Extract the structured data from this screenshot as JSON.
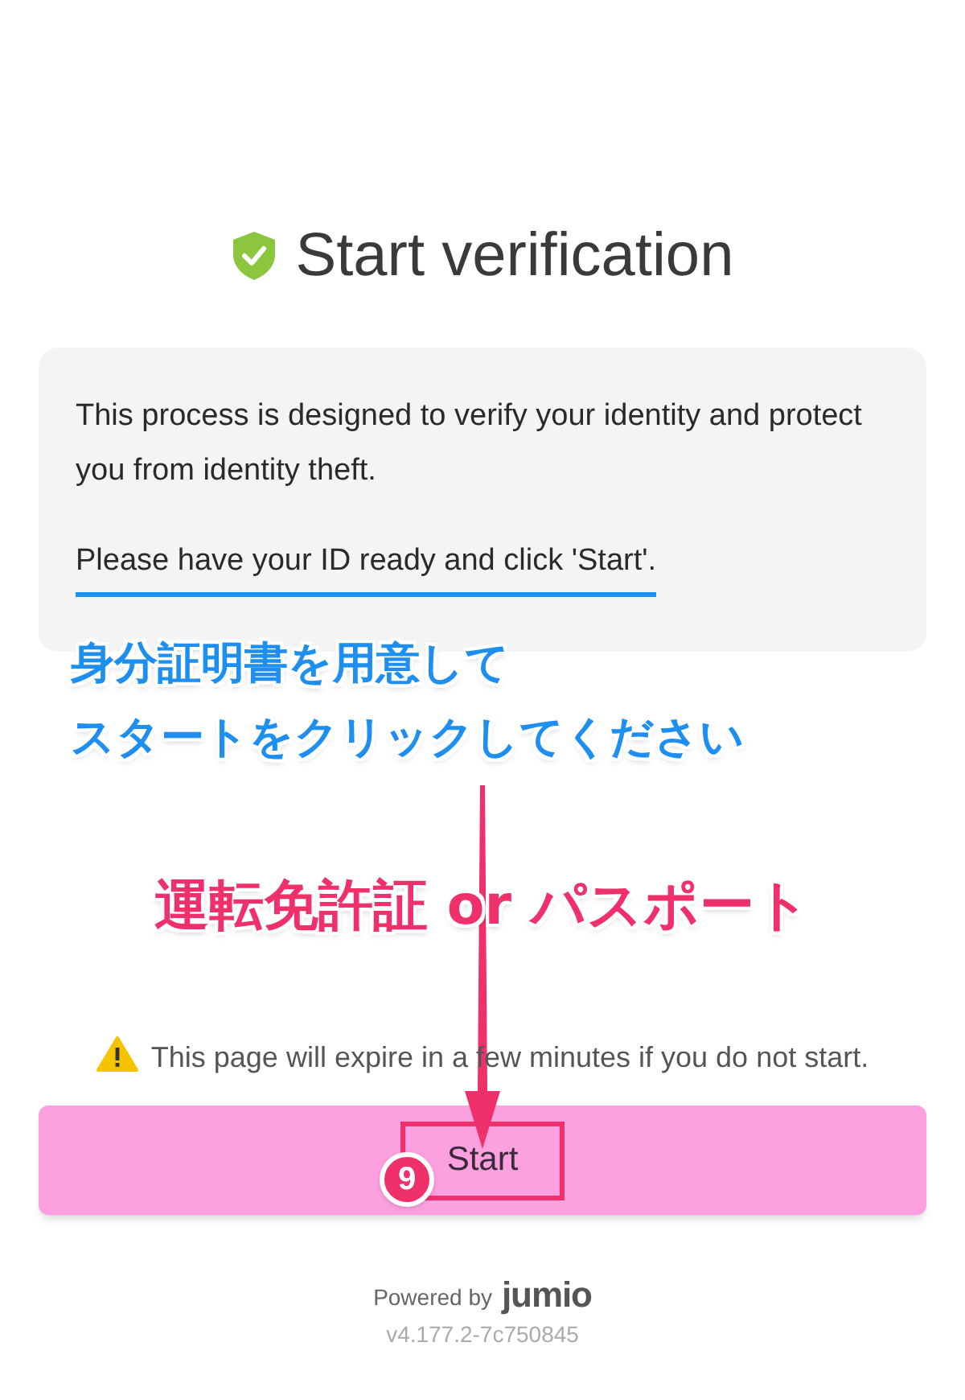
{
  "header": {
    "title": "Start verification"
  },
  "intro": {
    "paragraphs": [
      "This process is designed to verify your identity and protect you from identity theft.",
      "Please have your ID ready and click 'Start'."
    ]
  },
  "annotations": {
    "note_lines": [
      "身分証明書を用意して",
      "スタートをクリックしてください"
    ],
    "callout": "運転免許証 or パスポート",
    "step_badge": "9"
  },
  "warning": {
    "text": "This page will expire in a few minutes if you do not start."
  },
  "start_button": {
    "label": "Start"
  },
  "footer": {
    "powered_by": "Powered by",
    "brand": "jumio",
    "version": "v4.177.2-7c750845"
  }
}
